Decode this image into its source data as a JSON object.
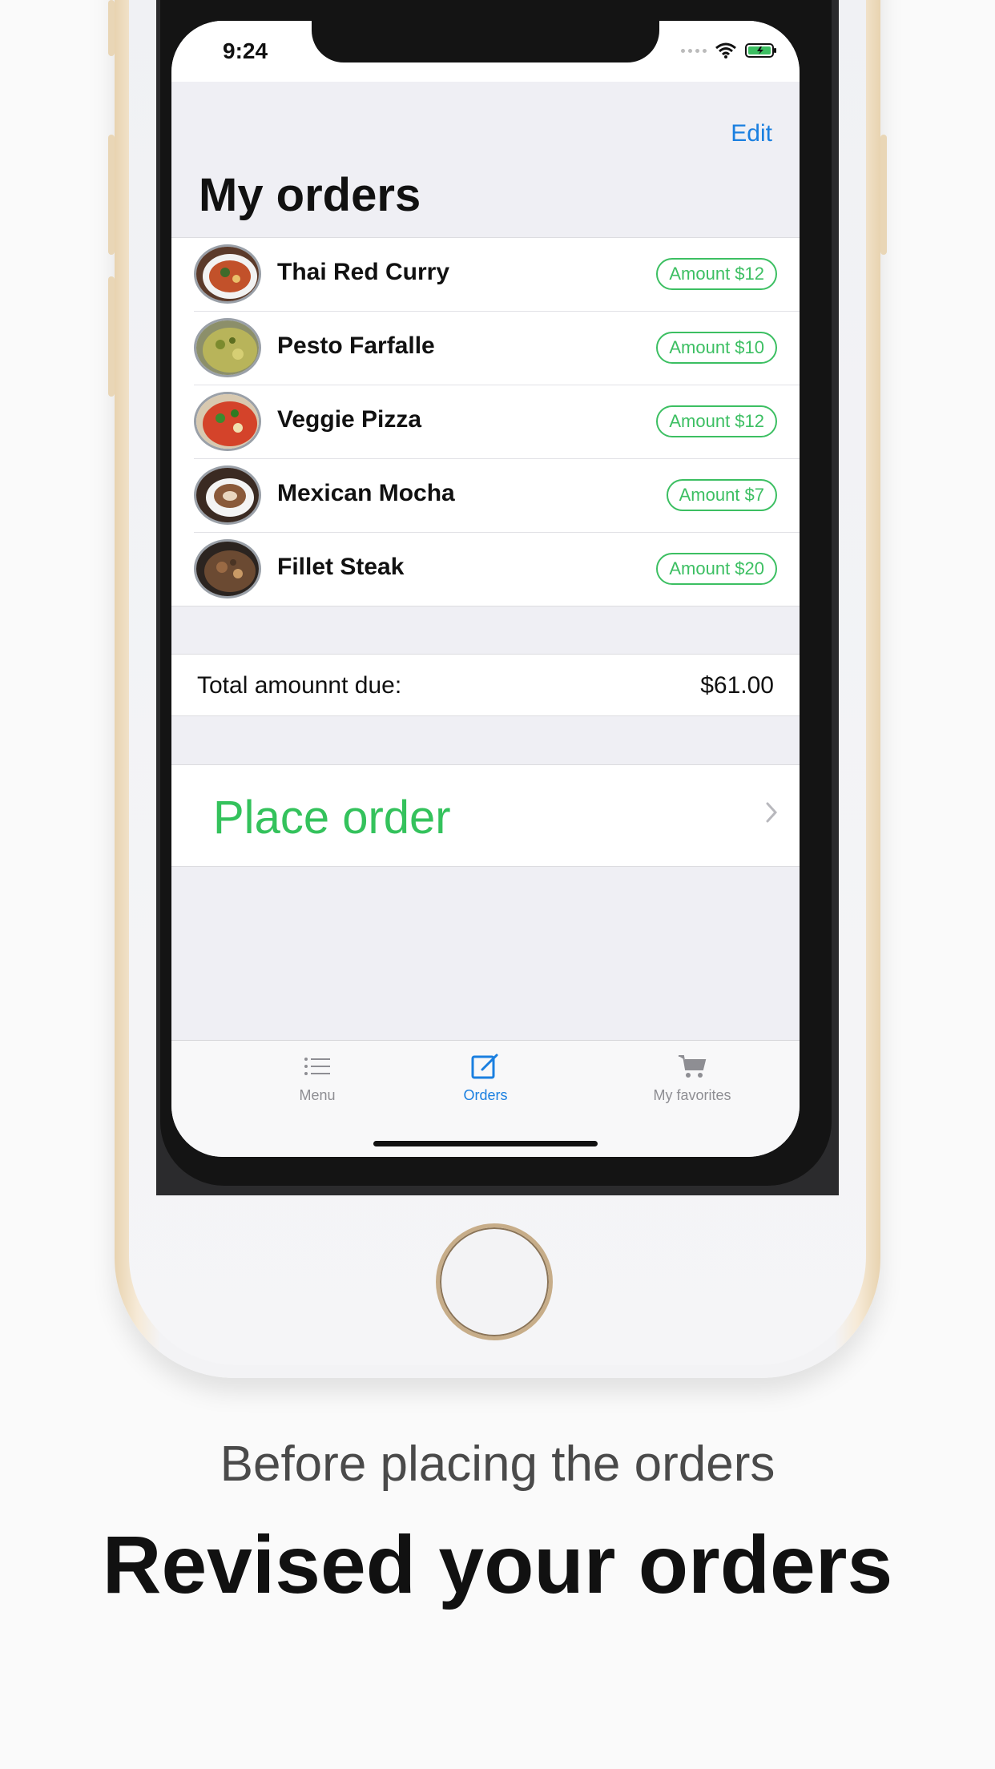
{
  "status_bar": {
    "time": "9:24"
  },
  "navbar": {
    "edit_label": "Edit",
    "title": "My orders"
  },
  "orders": [
    {
      "name": "Thai Red Curry",
      "amount": "Amount $12"
    },
    {
      "name": "Pesto Farfalle",
      "amount": "Amount $10"
    },
    {
      "name": "Veggie Pizza",
      "amount": "Amount $12"
    },
    {
      "name": "Mexican Mocha",
      "amount": "Amount $7"
    },
    {
      "name": "Fillet Steak",
      "amount": "Amount $20"
    }
  ],
  "total": {
    "label": "Total amounnt due:",
    "value": "$61.00"
  },
  "place_order": {
    "label": "Place order"
  },
  "tabbar": {
    "items": [
      {
        "label": "Menu",
        "icon": "list-icon"
      },
      {
        "label": "Orders",
        "icon": "compose-icon",
        "selected": true
      },
      {
        "label": "My favorites",
        "icon": "cart-icon"
      }
    ]
  },
  "caption": {
    "subtitle": "Before placing the orders",
    "title": "Revised your orders"
  },
  "colors": {
    "accent": "#1a7fe0",
    "green": "#34c25c",
    "pill_green": "#3cbf62"
  }
}
